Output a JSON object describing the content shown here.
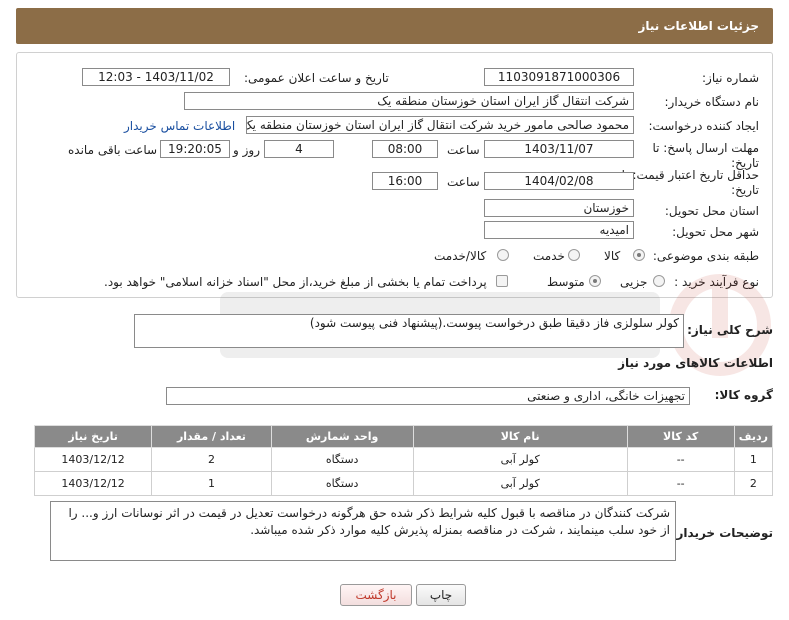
{
  "header": {
    "title": "جزئیات اطلاعات نیاز"
  },
  "fields": {
    "need_number_label": "شماره نیاز:",
    "need_number": "1103091871000306",
    "announce_label": "تاریخ و ساعت اعلان عمومی:",
    "announce_value": "1403/11/02 - 12:03",
    "buyer_org_label": "نام دستگاه خریدار:",
    "buyer_org": "شرکت انتقال گاز ایران  استان خوزستان منطقه یک",
    "creator_label": "ایجاد کننده درخواست:",
    "creator": "محمود صالحی مامور خرید شرکت انتقال گاز ایران  استان خوزستان منطقه یک",
    "contact_link": "اطلاعات تماس خریدار",
    "deadline_label": "مهلت ارسال پاسخ: تا تاریخ:",
    "deadline_date": "1403/11/07",
    "time_label": "ساعت",
    "deadline_time": "08:00",
    "days_value": "4",
    "days_label": "روز و",
    "remaining_time": "19:20:05",
    "remaining_label": "ساعت باقی مانده",
    "validity_label": "حداقل تاریخ اعتبار قیمت: تا تاریخ:",
    "validity_date": "1404/02/08",
    "validity_time": "16:00",
    "province_label": "استان محل تحویل:",
    "province": "خوزستان",
    "city_label": "شهر محل تحویل:",
    "city": "امیدیه",
    "category_label": "طبقه بندی موضوعی:",
    "category_options": [
      "کالا",
      "خدمت",
      "کالا/خدمت"
    ],
    "process_label": "نوع فرآیند خرید :",
    "process_options": [
      "جزیی",
      "متوسط"
    ],
    "payment_note": "پرداخت تمام یا بخشی از مبلغ خرید،از محل \"اسناد خزانه اسلامی\" خواهد بود."
  },
  "summary": {
    "label": "شرح کلی نیاز:",
    "text": "کولر سلولزی  فاز دقیقا طبق درخواست پیوست.(پیشنهاد فنی پیوست شود)"
  },
  "goods": {
    "section_title": "اطلاعات کالاهای مورد نیاز",
    "group_label": "گروه کالا:",
    "group_value": "تجهیزات خانگی، اداری و صنعتی",
    "columns": [
      "ردیف",
      "کد کالا",
      "نام کالا",
      "واحد شمارش",
      "تعداد / مقدار",
      "تاریخ نیاز"
    ],
    "rows": [
      [
        "1",
        "--",
        "کولر آبی",
        "دستگاه",
        "2",
        "1403/12/12"
      ],
      [
        "2",
        "--",
        "کولر آبی",
        "دستگاه",
        "1",
        "1403/12/12"
      ]
    ]
  },
  "notes": {
    "label": "توضیحات خریدار:",
    "text": "شرکت کنندگان در مناقصه با قبول کلیه شرایط ذکر شده حق هرگونه درخواست تعدیل در قیمت در اثر نوسانات ارز و... را از خود سلب مینمایند ، شرکت در مناقصه بمنزله پذیرش کلیه موارد ذکر شده میباشد."
  },
  "buttons": {
    "print": "چاپ",
    "back": "بازگشت"
  },
  "colors": {
    "header": "#8c6d47",
    "table_header": "#8a8a8a",
    "link": "#1a4fa0",
    "back_text": "#c0392b"
  }
}
